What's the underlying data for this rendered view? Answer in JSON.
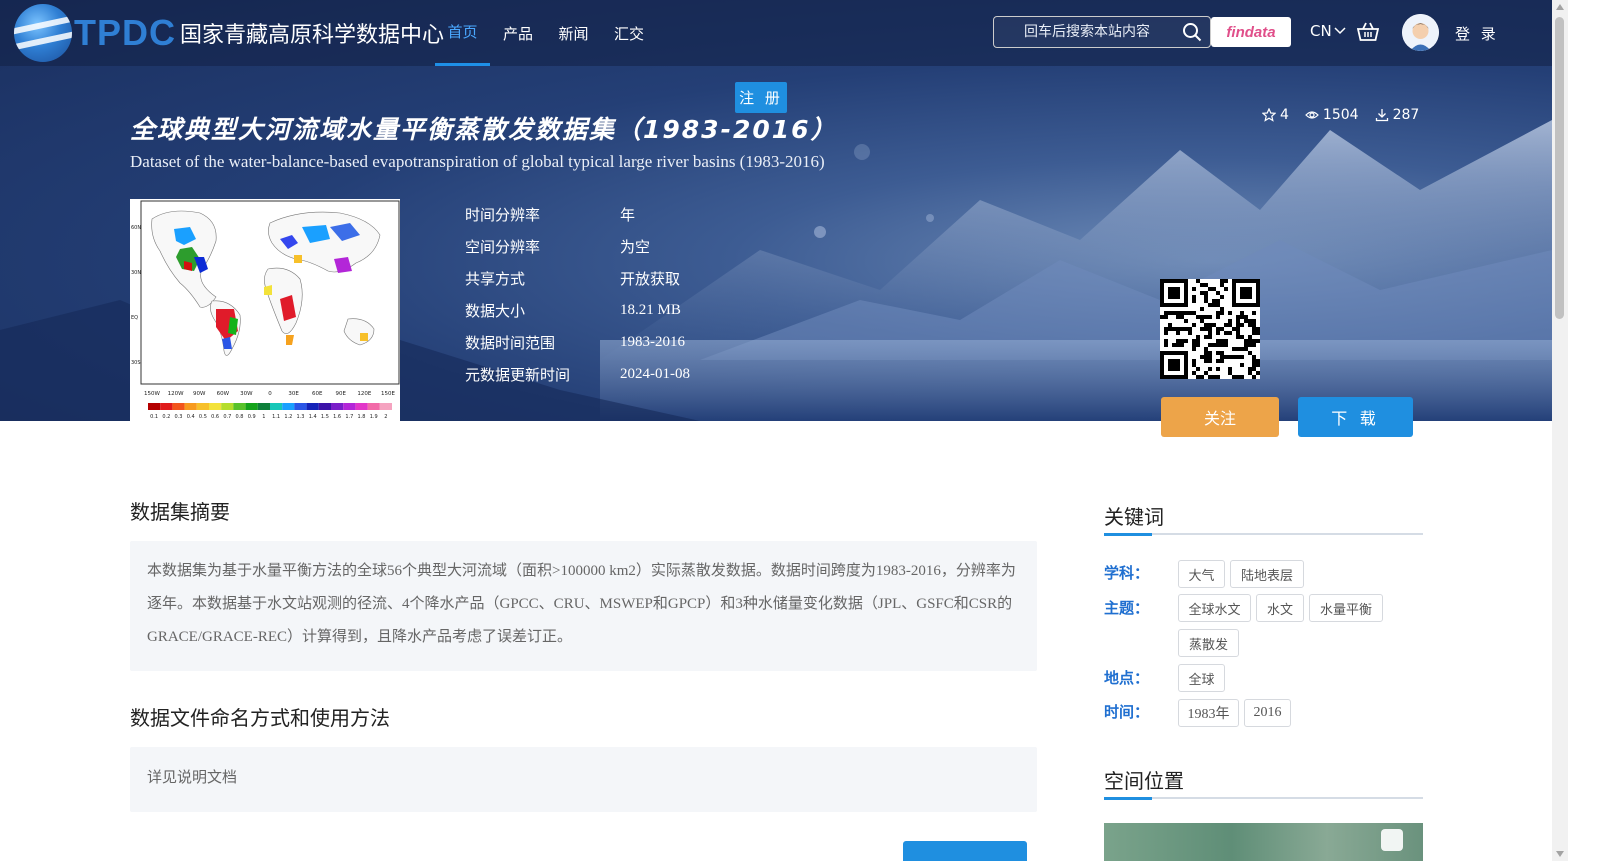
{
  "header": {
    "logo_abbr": "TPDC",
    "logo_name": "国家青藏高原科学数据中心",
    "nav": [
      {
        "label": "首页",
        "active": true
      },
      {
        "label": "产品",
        "active": false
      },
      {
        "label": "新闻",
        "active": false
      },
      {
        "label": "汇交",
        "active": false
      }
    ],
    "search_placeholder": "回车后搜索本站内容",
    "findata_label": "findata",
    "lang_label": "CN",
    "login_label": "登 录",
    "register_label": "注 册"
  },
  "dataset": {
    "title_cn": "全球典型大河流域水量平衡蒸散发数据集（1983-2016）",
    "title_en": "Dataset of the water-balance-based evapotranspiration of global typical large river basins (1983-2016)",
    "stats": {
      "stars": "4",
      "views": "1504",
      "downloads": "287"
    },
    "meta": [
      {
        "key": "时间分辨率",
        "value": "年"
      },
      {
        "key": "空间分辨率",
        "value": "为空"
      },
      {
        "key": "共享方式",
        "value": "开放获取"
      },
      {
        "key": "数据大小",
        "value": "18.21 MB"
      },
      {
        "key": "数据时间范围",
        "value": "1983-2016"
      },
      {
        "key": "元数据更新时间",
        "value": "2024-01-08"
      }
    ],
    "follow_label": "关注",
    "download_label": "下 载"
  },
  "thumbnail": {
    "x_ticks": [
      "150W",
      "120W",
      "90W",
      "60W",
      "30W",
      "0",
      "30E",
      "60E",
      "90E",
      "120E",
      "150E"
    ],
    "y_ticks": [
      "60N",
      "30N",
      "EQ",
      "30S"
    ],
    "colorbar_labels": [
      "0.1",
      "0.2",
      "0.3",
      "0.4",
      "0.5",
      "0.6",
      "0.7",
      "0.8",
      "0.9",
      "1",
      "1.1",
      "1.2",
      "1.3",
      "1.4",
      "1.5",
      "1.6",
      "1.7",
      "1.8",
      "1.9",
      "2"
    ]
  },
  "main": {
    "abstract_title": "数据集摘要",
    "abstract_text": "本数据集为基于水量平衡方法的全球56个典型大河流域（面积>100000 km2）实际蒸散发数据。数据时间跨度为1983-2016，分辨率为逐年。本数据基于水文站观测的径流、4个降水产品（GPCC、CRU、MSWEP和GPCP）和3种水储量变化数据（JPL、GSFC和CSR的GRACE/GRACE-REC）计算得到，且降水产品考虑了误差订正。",
    "naming_title": "数据文件命名方式和使用方法",
    "naming_text": "详见说明文档"
  },
  "sidebar": {
    "keywords_title": "关键词",
    "subject_label": "学科：",
    "subject_tags": [
      "大气",
      "陆地表层"
    ],
    "theme_label": "主题：",
    "theme_tags": [
      "全球水文",
      "水文",
      "水量平衡",
      "蒸散发"
    ],
    "place_label": "地点：",
    "place_tags": [
      "全球"
    ],
    "time_label": "时间：",
    "time_tags": [
      "1983年",
      "2016"
    ],
    "spatial_title": "空间位置"
  },
  "colors": {
    "accent": "#1f8fe0",
    "follow": "#eda449",
    "keyword_label": "#1f6fd0"
  }
}
